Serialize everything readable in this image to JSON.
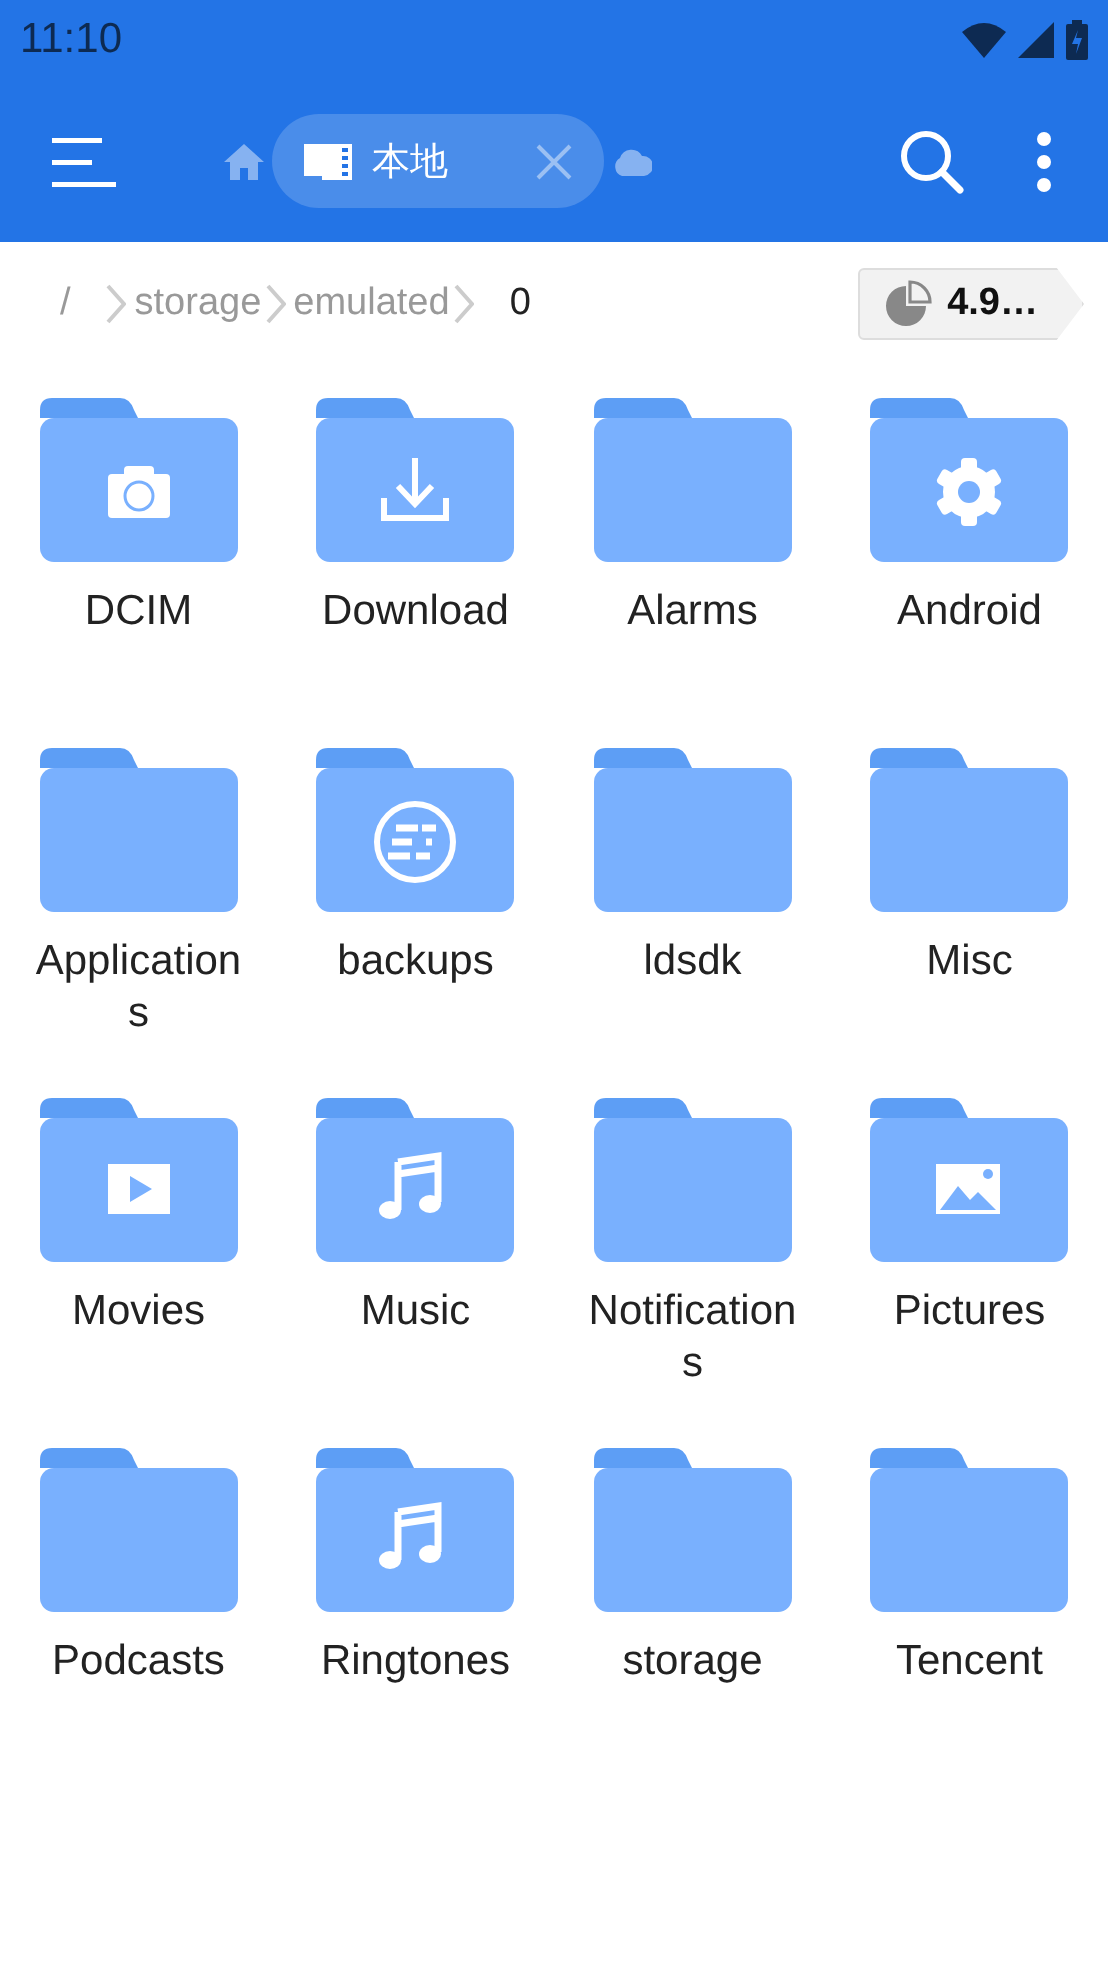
{
  "status_bar": {
    "time": "11:10"
  },
  "toolbar": {
    "tabs": [
      {
        "kind": "home",
        "selected": false
      },
      {
        "kind": "local",
        "label": "本地",
        "selected": true
      },
      {
        "kind": "cloud",
        "selected": false
      }
    ]
  },
  "breadcrumb": [
    {
      "label": "/",
      "current": false
    },
    {
      "label": "storage",
      "current": false
    },
    {
      "label": "emulated",
      "current": false
    },
    {
      "label": "0",
      "current": true
    }
  ],
  "storage_button": {
    "label": "4.9…"
  },
  "folders": [
    {
      "name": "DCIM",
      "kind": "camera"
    },
    {
      "name": "Download",
      "kind": "download"
    },
    {
      "name": "Alarms",
      "kind": "plain"
    },
    {
      "name": "Android",
      "kind": "gear"
    },
    {
      "name": "Applications",
      "kind": "plain"
    },
    {
      "name": "backups",
      "kind": "es"
    },
    {
      "name": "ldsdk",
      "kind": "plain"
    },
    {
      "name": "Misc",
      "kind": "plain"
    },
    {
      "name": "Movies",
      "kind": "movie"
    },
    {
      "name": "Music",
      "kind": "music"
    },
    {
      "name": "Notifications",
      "kind": "plain"
    },
    {
      "name": "Pictures",
      "kind": "picture"
    },
    {
      "name": "Podcasts",
      "kind": "plain"
    },
    {
      "name": "Ringtones",
      "kind": "music"
    },
    {
      "name": "storage",
      "kind": "plain"
    },
    {
      "name": "Tencent",
      "kind": "plain"
    }
  ]
}
